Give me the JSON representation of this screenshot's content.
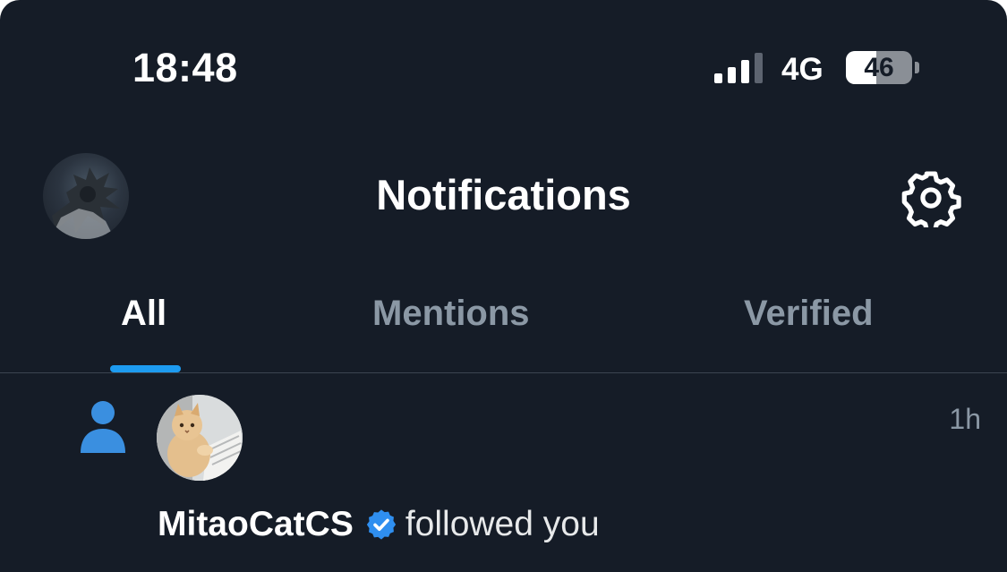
{
  "status_bar": {
    "time": "18:48",
    "network": "4G",
    "battery_level": "46",
    "battery_fraction": 0.46,
    "signal_bars_active": 3,
    "signal_bars_total": 4
  },
  "header": {
    "title": "Notifications",
    "profile_avatar_icon": "profile-avatar",
    "settings_icon": "gear-icon"
  },
  "tabs": [
    {
      "label": "All",
      "active": true
    },
    {
      "label": "Mentions",
      "active": false
    },
    {
      "label": "Verified",
      "active": false
    }
  ],
  "notifications": [
    {
      "type_icon": "person-follow-icon",
      "user": "MitaoCatCS",
      "verified": true,
      "action": "followed you",
      "time": "1h"
    }
  ],
  "colors": {
    "background": "#151c27",
    "accent": "#1d9bf0",
    "follow_icon": "#3a8fe0",
    "verified_badge": "#2f8ff0",
    "muted_text": "#8b98a5"
  }
}
